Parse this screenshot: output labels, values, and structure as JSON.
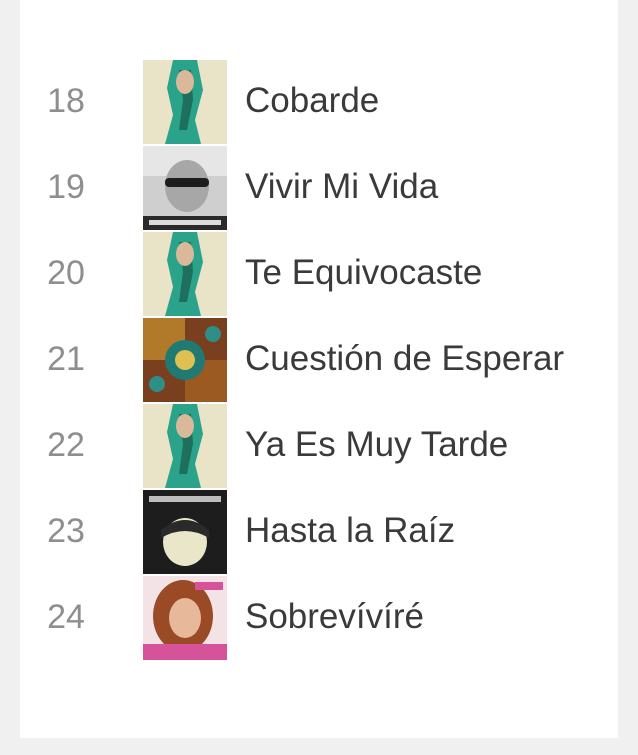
{
  "tracks": [
    {
      "rank": "18",
      "title": "Cobarde",
      "artwork": "green-hair-portrait-cover"
    },
    {
      "rank": "19",
      "title": "Vivir Mi Vida",
      "artwork": "sunglasses-man-grayscale-cover"
    },
    {
      "rank": "20",
      "title": "Te Equivocaste",
      "artwork": "green-hair-portrait-cover"
    },
    {
      "rank": "21",
      "title": "Cuestión de Esperar",
      "artwork": "ornate-mosaic-cover"
    },
    {
      "rank": "22",
      "title": "Ya Es Muy Tarde",
      "artwork": "green-hair-portrait-cover"
    },
    {
      "rank": "23",
      "title": "Hasta la Raíz",
      "artwork": "dark-portrait-cover"
    },
    {
      "rank": "24",
      "title": "Sobrevívíré",
      "artwork": "woman-portrait-pink-cover"
    }
  ]
}
